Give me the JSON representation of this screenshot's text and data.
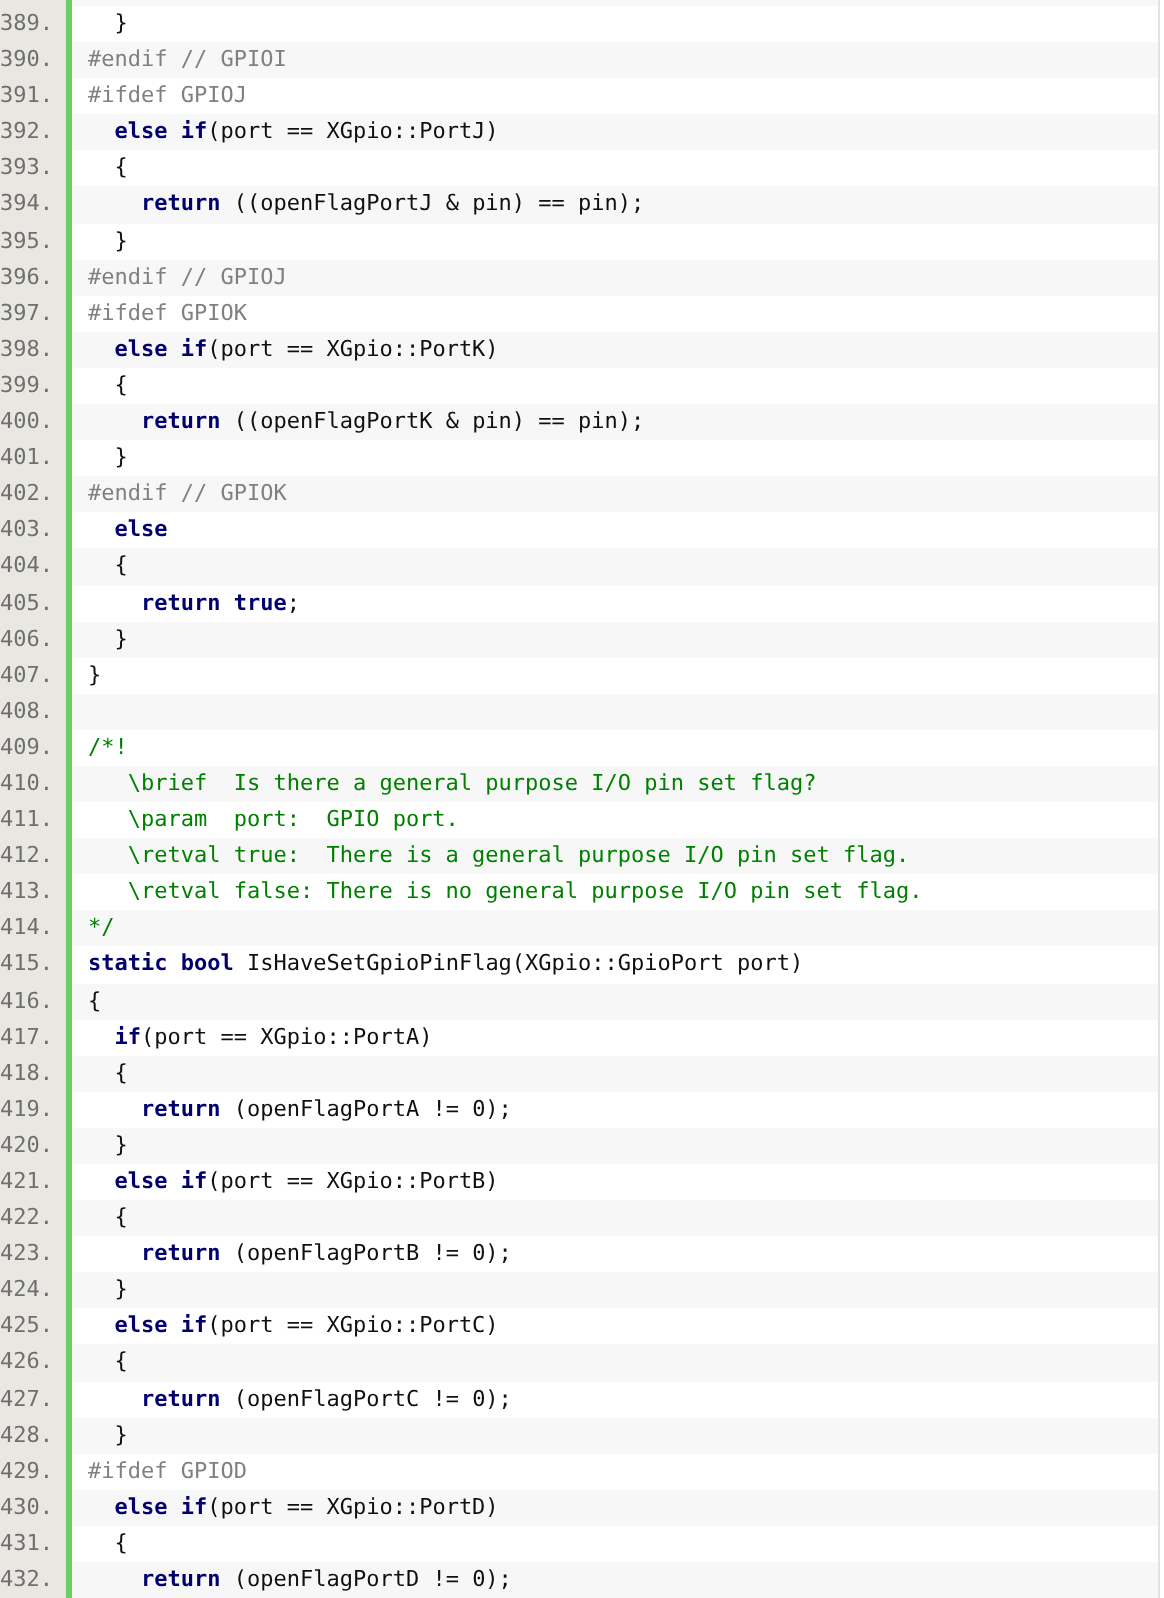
{
  "lines": [
    {
      "number": "389.",
      "tokens": [
        {
          "kind": "plain",
          "text": "  }"
        }
      ]
    },
    {
      "number": "390.",
      "tokens": [
        {
          "kind": "preproc",
          "text": "#endif // GPIOI"
        }
      ]
    },
    {
      "number": "391.",
      "tokens": [
        {
          "kind": "preproc",
          "text": "#ifdef GPIOJ"
        }
      ]
    },
    {
      "number": "392.",
      "tokens": [
        {
          "kind": "keyword",
          "text": "  else if"
        },
        {
          "kind": "plain",
          "text": "(port == XGpio::PortJ)"
        }
      ]
    },
    {
      "number": "393.",
      "tokens": [
        {
          "kind": "plain",
          "text": "  {"
        }
      ]
    },
    {
      "number": "394.",
      "tokens": [
        {
          "kind": "keyword",
          "text": "    return"
        },
        {
          "kind": "plain",
          "text": " ((openFlagPortJ & pin) == pin);"
        }
      ]
    },
    {
      "number": "395.",
      "tokens": [
        {
          "kind": "plain",
          "text": "  }"
        }
      ]
    },
    {
      "number": "396.",
      "tokens": [
        {
          "kind": "preproc",
          "text": "#endif // GPIOJ"
        }
      ]
    },
    {
      "number": "397.",
      "tokens": [
        {
          "kind": "preproc",
          "text": "#ifdef GPIOK"
        }
      ]
    },
    {
      "number": "398.",
      "tokens": [
        {
          "kind": "keyword",
          "text": "  else if"
        },
        {
          "kind": "plain",
          "text": "(port == XGpio::PortK)"
        }
      ]
    },
    {
      "number": "399.",
      "tokens": [
        {
          "kind": "plain",
          "text": "  {"
        }
      ]
    },
    {
      "number": "400.",
      "tokens": [
        {
          "kind": "keyword",
          "text": "    return"
        },
        {
          "kind": "plain",
          "text": " ((openFlagPortK & pin) == pin);"
        }
      ]
    },
    {
      "number": "401.",
      "tokens": [
        {
          "kind": "plain",
          "text": "  }"
        }
      ]
    },
    {
      "number": "402.",
      "tokens": [
        {
          "kind": "preproc",
          "text": "#endif // GPIOK"
        }
      ]
    },
    {
      "number": "403.",
      "tokens": [
        {
          "kind": "keyword",
          "text": "  else"
        }
      ]
    },
    {
      "number": "404.",
      "tokens": [
        {
          "kind": "plain",
          "text": "  {"
        }
      ]
    },
    {
      "number": "405.",
      "tokens": [
        {
          "kind": "keyword",
          "text": "    return true"
        },
        {
          "kind": "plain",
          "text": ";"
        }
      ]
    },
    {
      "number": "406.",
      "tokens": [
        {
          "kind": "plain",
          "text": "  }"
        }
      ]
    },
    {
      "number": "407.",
      "tokens": [
        {
          "kind": "plain",
          "text": "}"
        }
      ]
    },
    {
      "number": "408."
    },
    {
      "number": "409.",
      "tokens": [
        {
          "kind": "comment",
          "text": "/*!"
        }
      ]
    },
    {
      "number": "410.",
      "tokens": [
        {
          "kind": "comment",
          "text": "   \\brief  Is there a general purpose I/O pin set flag?"
        }
      ]
    },
    {
      "number": "411.",
      "tokens": [
        {
          "kind": "comment",
          "text": "   \\param  port:  GPIO port."
        }
      ]
    },
    {
      "number": "412.",
      "tokens": [
        {
          "kind": "comment",
          "text": "   \\retval true:  There is a general purpose I/O pin set flag."
        }
      ]
    },
    {
      "number": "413.",
      "tokens": [
        {
          "kind": "comment",
          "text": "   \\retval false: There is no general purpose I/O pin set flag."
        }
      ]
    },
    {
      "number": "414.",
      "tokens": [
        {
          "kind": "comment",
          "text": "*/"
        }
      ]
    },
    {
      "number": "415.",
      "tokens": [
        {
          "kind": "keyword",
          "text": "static bool"
        },
        {
          "kind": "plain",
          "text": " IsHaveSetGpioPinFlag(XGpio::GpioPort port)"
        }
      ]
    },
    {
      "number": "416.",
      "tokens": [
        {
          "kind": "plain",
          "text": "{"
        }
      ]
    },
    {
      "number": "417.",
      "tokens": [
        {
          "kind": "keyword",
          "text": "  if"
        },
        {
          "kind": "plain",
          "text": "(port == XGpio::PortA)"
        }
      ]
    },
    {
      "number": "418.",
      "tokens": [
        {
          "kind": "plain",
          "text": "  {"
        }
      ]
    },
    {
      "number": "419.",
      "tokens": [
        {
          "kind": "keyword",
          "text": "    return"
        },
        {
          "kind": "plain",
          "text": " (openFlagPortA != 0);"
        }
      ]
    },
    {
      "number": "420.",
      "tokens": [
        {
          "kind": "plain",
          "text": "  }"
        }
      ]
    },
    {
      "number": "421.",
      "tokens": [
        {
          "kind": "keyword",
          "text": "  else if"
        },
        {
          "kind": "plain",
          "text": "(port == XGpio::PortB)"
        }
      ]
    },
    {
      "number": "422.",
      "tokens": [
        {
          "kind": "plain",
          "text": "  {"
        }
      ]
    },
    {
      "number": "423.",
      "tokens": [
        {
          "kind": "keyword",
          "text": "    return"
        },
        {
          "kind": "plain",
          "text": " (openFlagPortB != 0);"
        }
      ]
    },
    {
      "number": "424.",
      "tokens": [
        {
          "kind": "plain",
          "text": "  }"
        }
      ]
    },
    {
      "number": "425.",
      "tokens": [
        {
          "kind": "keyword",
          "text": "  else if"
        },
        {
          "kind": "plain",
          "text": "(port == XGpio::PortC)"
        }
      ]
    },
    {
      "number": "426.",
      "tokens": [
        {
          "kind": "plain",
          "text": "  {"
        }
      ]
    },
    {
      "number": "427.",
      "tokens": [
        {
          "kind": "keyword",
          "text": "    return"
        },
        {
          "kind": "plain",
          "text": " (openFlagPortC != 0);"
        }
      ]
    },
    {
      "number": "428.",
      "tokens": [
        {
          "kind": "plain",
          "text": "  }"
        }
      ]
    },
    {
      "number": "429.",
      "tokens": [
        {
          "kind": "preproc",
          "text": "#ifdef GPIOD"
        }
      ]
    },
    {
      "number": "430.",
      "tokens": [
        {
          "kind": "keyword",
          "text": "  else if"
        },
        {
          "kind": "plain",
          "text": "(port == XGpio::PortD)"
        }
      ]
    },
    {
      "number": "431.",
      "tokens": [
        {
          "kind": "plain",
          "text": "  {"
        }
      ]
    },
    {
      "number": "432.",
      "tokens": [
        {
          "kind": "keyword",
          "text": "    return"
        },
        {
          "kind": "plain",
          "text": " (openFlagPortD != 0);"
        }
      ]
    }
  ]
}
